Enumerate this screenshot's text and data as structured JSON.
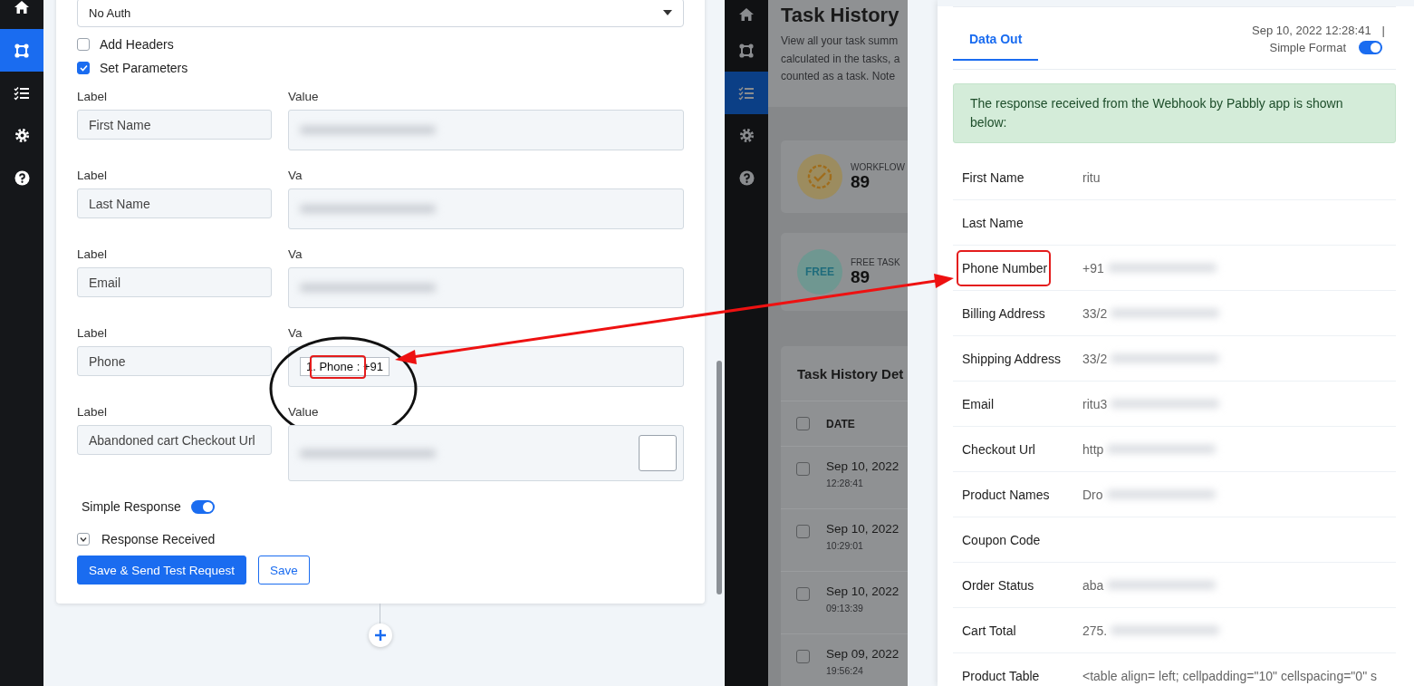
{
  "left_sidebar": {
    "items": [
      {
        "selected": false
      },
      {
        "selected": true
      },
      {
        "selected": false
      },
      {
        "selected": false
      },
      {
        "selected": false
      }
    ]
  },
  "builder": {
    "auth_select": {
      "value": "No Auth"
    },
    "checkboxes": [
      {
        "label": "Add Headers",
        "checked": false
      },
      {
        "label": "Set Parameters",
        "checked": true
      }
    ],
    "parameters": [
      {
        "label_caption": "Label",
        "label_value": "First Name",
        "value_caption": "Value",
        "annotated": false
      },
      {
        "label_caption": "Label",
        "label_value": "Last Name",
        "value_caption": "Va",
        "annotated": false
      },
      {
        "label_caption": "Label",
        "label_value": "Email",
        "value_caption": "Va",
        "annotated": false
      },
      {
        "label_caption": "Label",
        "label_value": "Phone",
        "value_caption": "Va",
        "value_chip": "1. Phone : +91",
        "annotated": true
      },
      {
        "label_caption": "Label",
        "label_value": "Abandoned cart Checkout Url",
        "value_caption": "Value",
        "annotated": false
      }
    ],
    "simple_response": {
      "label": "Simple Response",
      "on": true
    },
    "response_received": {
      "label": "Response Received",
      "expanded": false
    },
    "buttons": [
      {
        "label": "Save & Send Test Request",
        "kind": "primary"
      },
      {
        "label": "Save",
        "kind": "outline"
      }
    ]
  },
  "task_history": {
    "sidebar": {
      "items": [
        {
          "selected": false
        },
        {
          "selected": false
        },
        {
          "selected": true
        },
        {
          "selected": false
        },
        {
          "selected": false
        }
      ]
    },
    "title": "Task History",
    "description_lines": [
      "View all your task summ",
      "calculated in the tasks, a",
      "counted as a task. Note"
    ],
    "stats": [
      {
        "kind": "workflow",
        "label": "WORKFLOW",
        "value": "89"
      },
      {
        "kind": "free",
        "label": "FREE TASK",
        "value": "89",
        "icon_text": "FREE"
      }
    ],
    "table": {
      "title": "Task History Det",
      "columns": [
        "DATE"
      ],
      "header_checked": false,
      "rows": [
        {
          "date": "Sep 10, 2022",
          "time": "12:28:41",
          "checked": false
        },
        {
          "date": "Sep 10, 2022",
          "time": "10:29:01",
          "checked": false
        },
        {
          "date": "Sep 10, 2022",
          "time": "09:13:39",
          "checked": false
        },
        {
          "date": "Sep 09, 2022",
          "time": "19:56:24",
          "checked": false
        }
      ]
    }
  },
  "data_out": {
    "tabs": [
      {
        "label": "Data Out",
        "selected": true
      }
    ],
    "timestamp": "Sep 10, 2022 12:28:41",
    "separator": "|",
    "simple_format": {
      "label": "Simple Format",
      "on": true
    },
    "alert": "The response received from the Webhook by Pabbly app is shown below:",
    "fields": [
      {
        "label": "First Name",
        "value": "ritu",
        "redacted": false,
        "annotated": false
      },
      {
        "label": "Last Name",
        "annotated": false
      },
      {
        "label": "Phone Number",
        "value": "+91",
        "redacted": true,
        "annotated": true
      },
      {
        "label": "Billing Address",
        "value": "33/2",
        "redacted": true,
        "annotated": false
      },
      {
        "label": "Shipping Address",
        "value": "33/2",
        "redacted": true,
        "annotated": false
      },
      {
        "label": "Email",
        "value": "ritu3",
        "redacted": true,
        "annotated": false
      },
      {
        "label": "Checkout Url",
        "value": "http",
        "redacted": true,
        "annotated": false
      },
      {
        "label": "Product Names",
        "value": "Dro",
        "redacted": true,
        "annotated": false
      },
      {
        "label": "Coupon Code",
        "annotated": false
      },
      {
        "label": "Order Status",
        "value": "aba",
        "redacted": true,
        "annotated": false
      },
      {
        "label": "Cart Total",
        "value": "275.",
        "redacted": true,
        "annotated": false
      },
      {
        "label": "Product Table",
        "value": "<table align= left; cellpadding=\"10\" cellspacing=\"0\" s",
        "redacted": false,
        "annotated": false
      }
    ]
  }
}
